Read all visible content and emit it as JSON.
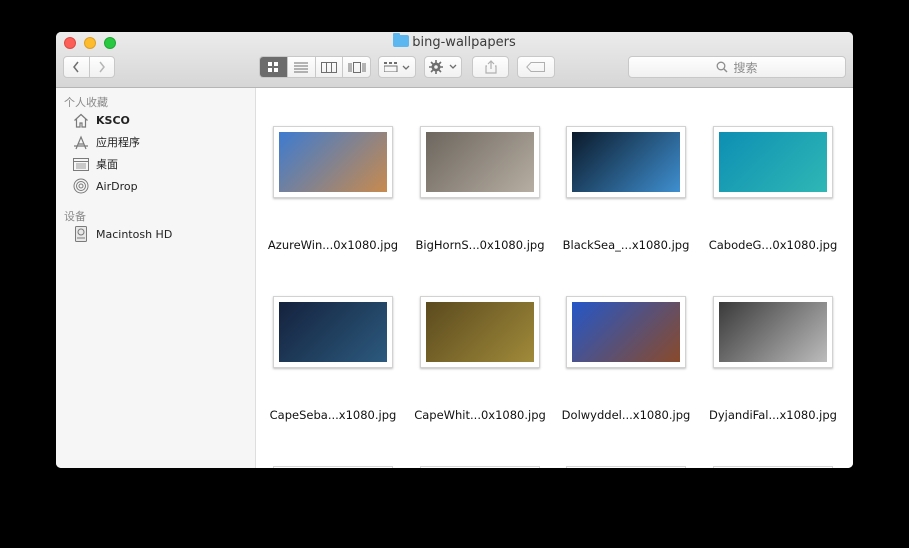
{
  "window": {
    "title": "bing-wallpapers"
  },
  "toolbar": {
    "back_label": "‹",
    "forward_label": "›",
    "view_modes": [
      "icons",
      "list",
      "columns",
      "coverflow"
    ],
    "search_placeholder": "搜索"
  },
  "sidebar": {
    "favorites_header": "个人收藏",
    "favorites": [
      {
        "label": "KSCO",
        "icon": "home-icon"
      },
      {
        "label": "应用程序",
        "icon": "applications-icon"
      },
      {
        "label": "桌面",
        "icon": "desktop-icon"
      },
      {
        "label": "AirDrop",
        "icon": "airdrop-icon"
      }
    ],
    "devices_header": "设备",
    "devices": [
      {
        "label": "Macintosh HD",
        "icon": "harddisk-icon"
      }
    ]
  },
  "files": [
    {
      "name": "AzureWin...0x1080.jpg",
      "colors": [
        "#3d7bd0",
        "#c88a4d"
      ]
    },
    {
      "name": "BigHornS...0x1080.jpg",
      "colors": [
        "#6d665e",
        "#b6aea2"
      ]
    },
    {
      "name": "BlackSea_...x1080.jpg",
      "colors": [
        "#0b1a2a",
        "#3f8fd0"
      ]
    },
    {
      "name": "CabodeG...0x1080.jpg",
      "colors": [
        "#0d8fb3",
        "#2fb7b5"
      ]
    },
    {
      "name": "CapeSeba...x1080.jpg",
      "colors": [
        "#14223d",
        "#2c5a7e"
      ]
    },
    {
      "name": "CapeWhit...0x1080.jpg",
      "colors": [
        "#5b4a1e",
        "#a08a3a"
      ]
    },
    {
      "name": "Dolwyddel...x1080.jpg",
      "colors": [
        "#2457c8",
        "#8a4a2a"
      ]
    },
    {
      "name": "DyjandiFal...x1080.jpg",
      "colors": [
        "#3a3a3a",
        "#bcbcbc"
      ]
    }
  ]
}
